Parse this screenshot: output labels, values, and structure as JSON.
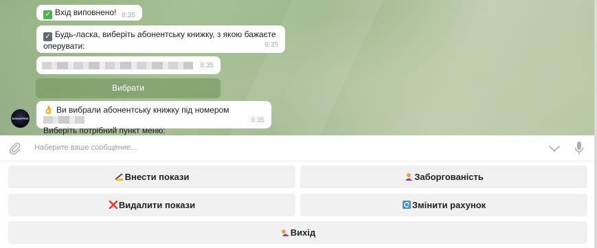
{
  "messages": {
    "login": {
      "text": "Вхід виповнено!",
      "time": "8:35"
    },
    "choose": {
      "text": "Будь-ласка, виберіть абонентську книжку, з якою бажаєте оперувати:",
      "time": "8:35"
    },
    "account_number": {
      "time": "8:35"
    },
    "selected": {
      "line1": "Ви вибрали абонентську книжку під номером",
      "line2": "Виберіть потрібний пункт меню:",
      "time": "8:35"
    }
  },
  "inline_button": {
    "label": "Вибрати"
  },
  "avatar": {
    "label": "БІЛЬБЕРЕЖ"
  },
  "composer": {
    "placeholder": "Наберите ваше сообщение..."
  },
  "keyboard": {
    "enter_readings": "Внести покази",
    "debt": "Заборгованість",
    "delete_readings": "Видалити покази",
    "change_account": "Змінити рахунок",
    "exit": "Вихід"
  },
  "colors": {
    "accent": "#789b64",
    "bubble": "#ffffff",
    "key_bg": "#f0f0f0"
  }
}
